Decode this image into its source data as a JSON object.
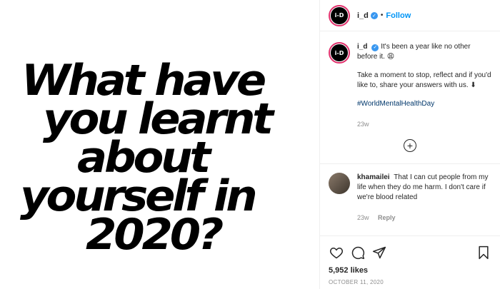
{
  "post": {
    "headline_lines": [
      "What have",
      "you learnt",
      "about",
      "yourself in",
      "2020?"
    ]
  },
  "header": {
    "username": "i_d",
    "separator": "•",
    "follow_label": "Follow",
    "avatar_text": "i-D"
  },
  "caption": {
    "username": "i_d",
    "text1": "It's been a year like no other before it.",
    "emoji1": "😩",
    "text2": "Take a moment to stop, reflect and if you'd like to, share your answers with us.",
    "emoji2": "⬇",
    "hashtag": "#WorldMentalHealthDay",
    "time": "23w"
  },
  "load_more_icon": "plus-circle-icon",
  "comment": {
    "username": "khamailei",
    "text": "That I can cut people from my life when they do me harm. I don't care if we're blood related",
    "time": "23w",
    "reply_label": "Reply"
  },
  "actions": {
    "icons": [
      "heart-icon",
      "comment-icon",
      "share-icon",
      "bookmark-icon"
    ],
    "likes": "5,952 likes",
    "date": "OCTOBER 11, 2020"
  },
  "colors": {
    "link": "#0095f6",
    "hashtag": "#00376b",
    "muted": "#8e8e8e",
    "ring": "#e1306c"
  }
}
